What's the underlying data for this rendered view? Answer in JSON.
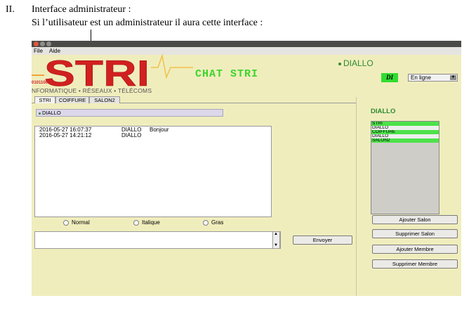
{
  "document": {
    "section_number": "II.",
    "heading": "Interface administrateur :",
    "sentence": "Si l’utilisateur est un administrateur il aura cette interface :"
  },
  "menu": {
    "file": "File",
    "aide": "Aide"
  },
  "logo": {
    "text": "STRI",
    "binary": "0101100",
    "tagline": "NFORMATIQUE • RÉSEAUX • TÉLÉCOMS"
  },
  "app_title": "CHAT STRI",
  "user": {
    "name": "DIALLO",
    "initials": "DI"
  },
  "status": {
    "value": "En ligne"
  },
  "tabs": [
    {
      "label": "STRI",
      "active": true
    },
    {
      "label": "COIFFURE",
      "active": false
    },
    {
      "label": "SALON2",
      "active": false
    }
  ],
  "room_header": "DIALLO",
  "messages": [
    {
      "date": "2016-05-27 16:07:37",
      "user": "DIALLO",
      "text": "Bonjour"
    },
    {
      "date": "2016-05-27 14:21:12",
      "user": "DIALLO",
      "text": ""
    }
  ],
  "format_options": [
    "Normal",
    "Italique",
    "Gras"
  ],
  "send_label": "Envoyer",
  "sidebar": {
    "title": "DIALLO",
    "list": [
      {
        "label": "STRI",
        "highlight": true
      },
      {
        "label": "DIALLO",
        "highlight": false
      },
      {
        "label": "COIFFURE",
        "highlight": true
      },
      {
        "label": "DIALLO",
        "highlight": false
      },
      {
        "label": "SALON2",
        "highlight": true
      }
    ],
    "buttons": {
      "add_salon": "Ajouter Salon",
      "delete_salon": "Supprimer Salon",
      "add_member": "Ajouter Membre",
      "delete_member": "Supprimer Membre"
    }
  },
  "colors": {
    "window_bg": "#f0edbd",
    "accent_green": "#3bd62a",
    "highlight_green": "#4de24a",
    "logo_red": "#d12020"
  }
}
